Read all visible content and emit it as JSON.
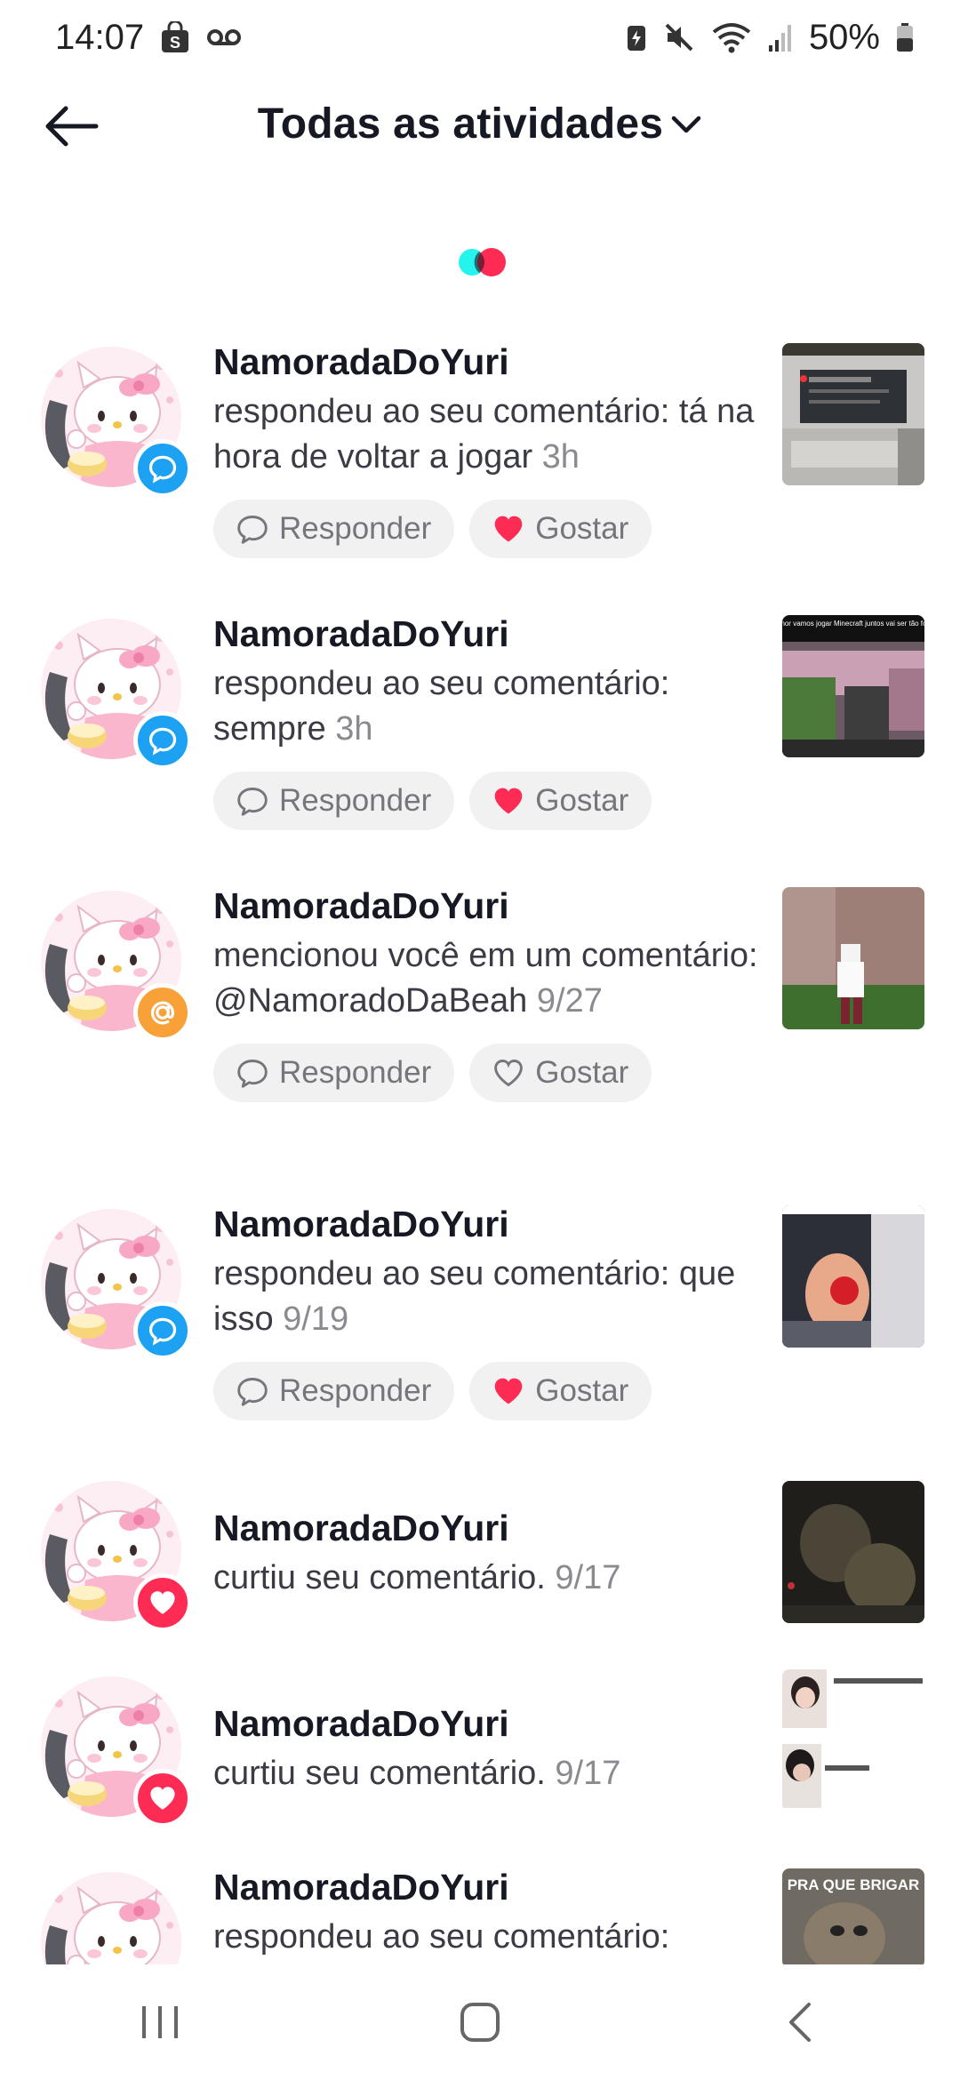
{
  "status_bar": {
    "time": "14:07",
    "battery": "50%",
    "left_icons": [
      "shopping-bag-icon",
      "voicemail-icon"
    ],
    "right_icons": [
      "battery-saver-icon",
      "mute-icon",
      "wifi-icon",
      "signal-icon",
      "battery-icon"
    ]
  },
  "header": {
    "title": "Todas as atividades",
    "back_icon": "arrow-left-icon",
    "dropdown_icon": "chevron-down-icon"
  },
  "colors": {
    "comment_badge": "#1da1f2",
    "mention_badge": "#f7a138",
    "like_badge": "#fe2c55",
    "heart_liked": "#fe2c55",
    "loader_cyan": "#25f4ee",
    "loader_red": "#fe2c55"
  },
  "activities": [
    {
      "username": "NamoradaDoYuri",
      "text": "respondeu ao seu comentário: tá na hora de voltar a jogar",
      "time": "3h",
      "badge": "comment",
      "actions": {
        "reply": "Responder",
        "like": "Gostar",
        "liked": true
      }
    },
    {
      "username": "NamoradaDoYuri",
      "text": "respondeu ao seu comentário: sempre",
      "time": "3h",
      "badge": "comment",
      "thumb_caption": "\"Amor vamos jogar Minecraft juntos vai ser tão fofo\"",
      "actions": {
        "reply": "Responder",
        "like": "Gostar",
        "liked": true
      }
    },
    {
      "username": "NamoradaDoYuri",
      "text": "mencionou você em um comentário: @NamoradoDaBeah",
      "time": "9/27",
      "badge": "mention",
      "actions": {
        "reply": "Responder",
        "like": "Gostar",
        "liked": false
      }
    },
    {
      "username": "NamoradaDoYuri",
      "text": "respondeu ao seu comentário: que isso",
      "time": "9/19",
      "badge": "comment",
      "actions": {
        "reply": "Responder",
        "like": "Gostar",
        "liked": true
      }
    },
    {
      "username": "NamoradaDoYuri",
      "text": "curtiu seu comentário.",
      "time": "9/17",
      "badge": "like"
    },
    {
      "username": "NamoradaDoYuri",
      "text": "curtiu seu comentário.",
      "time": "9/17",
      "badge": "like"
    },
    {
      "username": "NamoradaDoYuri",
      "text": "respondeu ao seu comentário:",
      "time": "",
      "badge": "comment",
      "thumb_caption": "PRA QUE BRIGAR"
    }
  ],
  "nav_bar": {
    "icons": [
      "recent-apps-icon",
      "home-icon",
      "back-icon"
    ]
  }
}
